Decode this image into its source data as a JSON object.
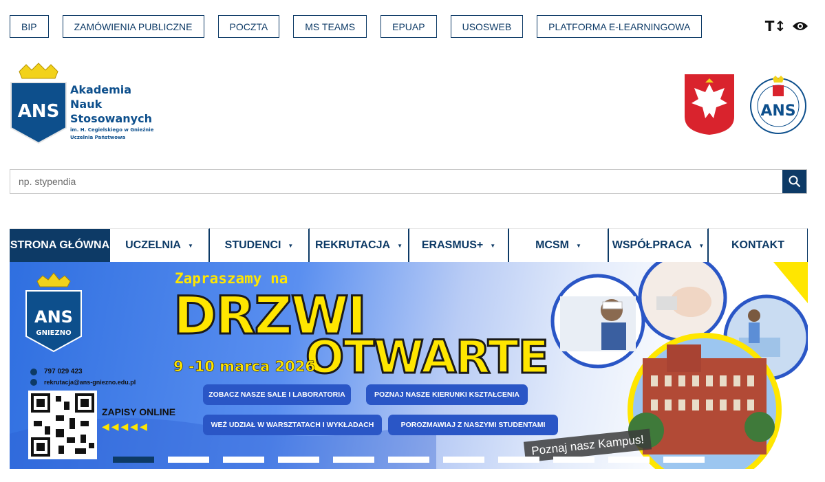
{
  "top_links": [
    "BIP",
    "ZAMÓWIENIA PUBLICZNE",
    "POCZTA",
    "MS TEAMS",
    "EPUAP",
    "USOSWEB",
    "PLATFORMA E-LEARNINGOWA"
  ],
  "accessibility": {
    "text_size_icon": "text-size-icon",
    "contrast_icon": "eye-icon",
    "text_size_glyph": "T↕"
  },
  "logo": {
    "abbr": "ANS",
    "line1": "Akademia",
    "line2": "Nauk",
    "line3": "Stosowanych",
    "sub1": "im. H. Cegielskiego w Gnieźnie",
    "sub2": "Uczelnia Państwowa"
  },
  "search": {
    "placeholder": "np. stypendia"
  },
  "nav": [
    {
      "label": "STRONA GŁÓWNA",
      "active": true,
      "caret": false
    },
    {
      "label": "UCZELNIA",
      "caret": true
    },
    {
      "label": "STUDENCI",
      "caret": true
    },
    {
      "label": "REKRUTACJA",
      "caret": true
    },
    {
      "label": "ERASMUS+",
      "caret": true
    },
    {
      "label": "MCSM",
      "caret": true
    },
    {
      "label": "WSPÓŁPRACA",
      "caret": true
    },
    {
      "label": "KONTAKT",
      "caret": false
    }
  ],
  "banner": {
    "badge_abbr": "ANS",
    "badge_city": "GNIEZNO",
    "invite": "Zapraszamy na",
    "title1": "DRZWI",
    "title2": "OTWARTE",
    "date": "9 -10 marca 2026",
    "phone": "797 029 423",
    "email": "rekrutacja@ans-gniezno.edu.pl",
    "zapisy": "ZAPISY ONLINE",
    "pills": [
      "ZOBACZ NASZE SALE I LABORATORIA",
      "POZNAJ NASZE KIERUNKI KSZTAŁCENIA",
      "WEŹ UDZIAŁ W WARSZTATACH  I WYKŁADACH",
      "POROZMAWIAJ Z NASZYMI STUDENTAMI"
    ],
    "kampus": "Poznaj nasz Kampus!"
  },
  "slider": {
    "count": 11,
    "active_index": 0
  },
  "colors": {
    "navy": "#0d3a66",
    "yellow": "#ffe600",
    "banner_blue": "#2f6fe0"
  }
}
